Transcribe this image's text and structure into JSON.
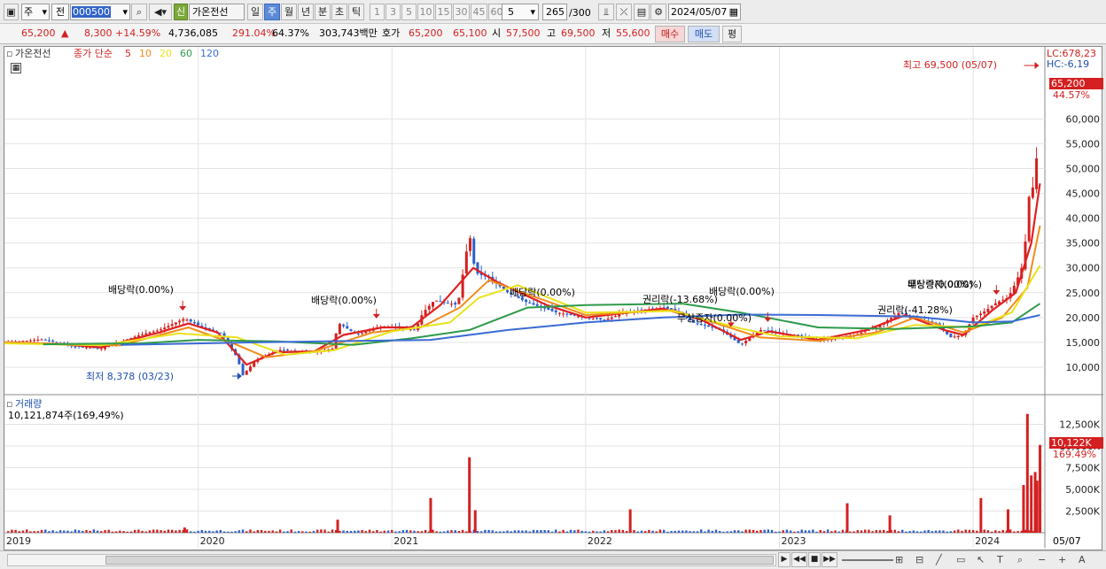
{
  "toolbar": {
    "type": "주",
    "mode": "전",
    "code": "000500",
    "new_badge": "신",
    "name": "가온전선",
    "periods": [
      "일",
      "주",
      "월",
      "년",
      "분",
      "초",
      "틱"
    ],
    "selected_period": "주",
    "intervals": [
      "1",
      "3",
      "5",
      "10",
      "15",
      "30",
      "45",
      "60"
    ],
    "interval_value": "5",
    "count": "265",
    "count_total": "/300",
    "date": "2024/05/07"
  },
  "quote": {
    "price": "65,200",
    "arrow": "▲",
    "change": "8,300",
    "change_pct": "+14.59%",
    "volume": "4,736,085",
    "vol_ratio": "291.04%",
    "turnover": "64.37%",
    "amount": "303,743백만",
    "bid_label": "호가",
    "ask": "65,200",
    "bid": "65,100",
    "open_label": "시",
    "open": "57,500",
    "high_label": "고",
    "high": "69,500",
    "low_label": "저",
    "low": "55,600",
    "buy": "매수",
    "sell": "매도",
    "eval": "평"
  },
  "legend": {
    "name": "가온전선",
    "prefix": "종가 단순",
    "ma": [
      {
        "label": "5",
        "color": "#e02020"
      },
      {
        "label": "10",
        "color": "#f08c1c"
      },
      {
        "label": "20",
        "color": "#e8e21a"
      },
      {
        "label": "60",
        "color": "#2e9a4a"
      },
      {
        "label": "120",
        "color": "#3a6bd4"
      }
    ]
  },
  "annotations": {
    "high": "최고 69,500 (05/07)",
    "low": "최저 8,378 (03/23)",
    "div1": "배당락(0.00%)",
    "div2": "배당락(0.00%)",
    "div3": "배당락(0.00%)",
    "rights1": "권리락(-13.68%)",
    "bonus1": "무상증자(0.00%)",
    "div4": "배당락(0.00%)",
    "div5": "배당락(0.00%)",
    "bonus2": "무상증자(0.00%)",
    "rights2": "권리락(-41.28%)"
  },
  "price_axis": {
    "lc": "LC:678,23",
    "hc": "HC:-6,19",
    "last_price": "65,200",
    "last_pct": "44.57%"
  },
  "volume_panel": {
    "title": "거래량",
    "value": "10,121,874주(169,49%)",
    "axis_last": "10,122K",
    "axis_pct": "169.49%"
  },
  "date_end": "05/07",
  "colors": {
    "up": "#d42020",
    "down": "#2a5fd0",
    "accent": "#5b8bd6"
  },
  "chart_data": {
    "type": "candlestick",
    "price": {
      "x_years": [
        "2019",
        "2020",
        "2021",
        "2022",
        "2023",
        "2024"
      ],
      "ylim": [
        5000,
        72000
      ],
      "yticks": [
        10000,
        15000,
        20000,
        25000,
        30000,
        35000,
        40000,
        45000,
        50000,
        55000,
        60000
      ],
      "ytick_labels": [
        "10,000",
        "15,000",
        "20,000",
        "25,000",
        "30,000",
        "35,000",
        "40,000",
        "45,000",
        "50,000",
        "55,000",
        "60,000"
      ],
      "close_path": [
        [
          2019.0,
          15000
        ],
        [
          2019.2,
          15600
        ],
        [
          2019.35,
          14200
        ],
        [
          2019.5,
          13800
        ],
        [
          2019.7,
          16500
        ],
        [
          2019.8,
          17500
        ],
        [
          2019.93,
          19800
        ],
        [
          2020.05,
          17500
        ],
        [
          2020.12,
          16800
        ],
        [
          2020.2,
          12000
        ],
        [
          2020.23,
          8378
        ],
        [
          2020.3,
          11500
        ],
        [
          2020.42,
          13500
        ],
        [
          2020.5,
          13200
        ],
        [
          2020.6,
          13000
        ],
        [
          2020.7,
          13800
        ],
        [
          2020.72,
          19000
        ],
        [
          2020.82,
          16500
        ],
        [
          2020.92,
          18000
        ],
        [
          2021.0,
          18200
        ],
        [
          2021.12,
          17500
        ],
        [
          2021.16,
          21000
        ],
        [
          2021.22,
          23500
        ],
        [
          2021.34,
          22500
        ],
        [
          2021.4,
          37000
        ],
        [
          2021.43,
          29000
        ],
        [
          2021.5,
          28000
        ],
        [
          2021.6,
          25000
        ],
        [
          2021.7,
          23000
        ],
        [
          2021.85,
          21000
        ],
        [
          2022.0,
          20000
        ],
        [
          2022.1,
          19500
        ],
        [
          2022.2,
          21000
        ],
        [
          2022.4,
          22000
        ],
        [
          2022.5,
          21000
        ],
        [
          2022.55,
          19000
        ],
        [
          2022.7,
          17500
        ],
        [
          2022.8,
          14500
        ],
        [
          2022.9,
          17500
        ],
        [
          2023.0,
          17000
        ],
        [
          2023.2,
          15500
        ],
        [
          2023.35,
          16000
        ],
        [
          2023.5,
          18000
        ],
        [
          2023.62,
          21000
        ],
        [
          2023.7,
          20000
        ],
        [
          2023.82,
          18500
        ],
        [
          2023.88,
          16000
        ],
        [
          2023.95,
          16500
        ],
        [
          2024.0,
          20000
        ],
        [
          2024.05,
          21000
        ],
        [
          2024.12,
          23000
        ],
        [
          2024.18,
          24000
        ],
        [
          2024.22,
          27000
        ],
        [
          2024.26,
          31000
        ],
        [
          2024.29,
          45000
        ],
        [
          2024.32,
          47000
        ],
        [
          2024.345,
          65200
        ]
      ],
      "ma": [
        {
          "name": "5",
          "points": [
            [
              2019.0,
              15000
            ],
            [
              2019.3,
              14600
            ],
            [
              2019.5,
              14000
            ],
            [
              2019.8,
              17000
            ],
            [
              2019.95,
              18800
            ],
            [
              2020.1,
              17000
            ],
            [
              2020.25,
              10500
            ],
            [
              2020.4,
              13000
            ],
            [
              2020.6,
              13200
            ],
            [
              2020.75,
              16500
            ],
            [
              2020.95,
              18000
            ],
            [
              2021.1,
              18000
            ],
            [
              2021.25,
              22500
            ],
            [
              2021.42,
              30000
            ],
            [
              2021.55,
              27000
            ],
            [
              2021.8,
              22500
            ],
            [
              2022.0,
              20000
            ],
            [
              2022.4,
              21800
            ],
            [
              2022.6,
              19500
            ],
            [
              2022.8,
              15500
            ],
            [
              2022.95,
              17200
            ],
            [
              2023.2,
              15500
            ],
            [
              2023.45,
              17500
            ],
            [
              2023.65,
              20500
            ],
            [
              2023.85,
              17500
            ],
            [
              2023.95,
              16500
            ],
            [
              2024.1,
              21500
            ],
            [
              2024.22,
              25000
            ],
            [
              2024.3,
              35000
            ],
            [
              2024.345,
              47000
            ]
          ]
        },
        {
          "name": "10",
          "points": [
            [
              2019.0,
              15000
            ],
            [
              2019.4,
              14600
            ],
            [
              2019.6,
              14400
            ],
            [
              2019.95,
              18000
            ],
            [
              2020.2,
              14500
            ],
            [
              2020.35,
              12000
            ],
            [
              2020.6,
              13200
            ],
            [
              2020.9,
              17000
            ],
            [
              2021.15,
              18000
            ],
            [
              2021.35,
              22000
            ],
            [
              2021.5,
              27500
            ],
            [
              2021.75,
              24000
            ],
            [
              2022.0,
              20500
            ],
            [
              2022.45,
              21500
            ],
            [
              2022.7,
              18500
            ],
            [
              2022.9,
              16000
            ],
            [
              2023.2,
              15300
            ],
            [
              2023.5,
              17000
            ],
            [
              2023.7,
              20000
            ],
            [
              2023.95,
              17000
            ],
            [
              2024.15,
              20000
            ],
            [
              2024.28,
              26000
            ],
            [
              2024.345,
              38500
            ]
          ]
        },
        {
          "name": "20",
          "points": [
            [
              2019.0,
              14800
            ],
            [
              2019.5,
              14400
            ],
            [
              2019.9,
              16800
            ],
            [
              2020.2,
              16000
            ],
            [
              2020.45,
              12500
            ],
            [
              2020.7,
              13400
            ],
            [
              2021.0,
              17200
            ],
            [
              2021.3,
              19000
            ],
            [
              2021.45,
              24000
            ],
            [
              2021.65,
              26500
            ],
            [
              2022.0,
              21000
            ],
            [
              2022.45,
              21300
            ],
            [
              2022.8,
              17800
            ],
            [
              2023.0,
              16200
            ],
            [
              2023.4,
              15800
            ],
            [
              2023.7,
              18500
            ],
            [
              2024.0,
              18000
            ],
            [
              2024.2,
              21000
            ],
            [
              2024.345,
              30500
            ]
          ]
        },
        {
          "name": "60",
          "points": [
            [
              2019.2,
              14600
            ],
            [
              2019.7,
              14800
            ],
            [
              2020.0,
              15500
            ],
            [
              2020.4,
              15200
            ],
            [
              2020.8,
              14500
            ],
            [
              2021.1,
              15800
            ],
            [
              2021.4,
              17500
            ],
            [
              2021.7,
              22000
            ],
            [
              2022.0,
              22500
            ],
            [
              2022.5,
              22800
            ],
            [
              2022.8,
              21000
            ],
            [
              2023.2,
              18000
            ],
            [
              2023.6,
              17700
            ],
            [
              2024.0,
              18200
            ],
            [
              2024.2,
              19000
            ],
            [
              2024.345,
              22800
            ]
          ]
        },
        {
          "name": "120",
          "points": [
            [
              2019.6,
              14500
            ],
            [
              2020.3,
              15000
            ],
            [
              2020.8,
              15300
            ],
            [
              2021.2,
              15500
            ],
            [
              2021.6,
              17500
            ],
            [
              2022.0,
              19000
            ],
            [
              2022.4,
              20000
            ],
            [
              2022.8,
              20600
            ],
            [
              2023.2,
              20500
            ],
            [
              2023.7,
              20200
            ],
            [
              2024.0,
              19000
            ],
            [
              2024.2,
              19200
            ],
            [
              2024.345,
              20500
            ]
          ]
        }
      ]
    },
    "volume": {
      "ylim": [
        0,
        15000
      ],
      "yticks_k": [
        2500,
        5000,
        7500,
        10000,
        12500
      ],
      "ytick_labels": [
        "2,500K",
        "5,000K",
        "7,500K",
        "10,000K",
        "12,500K"
      ],
      "spikes_k": [
        [
          2019.93,
          600
        ],
        [
          2020.72,
          1500
        ],
        [
          2021.2,
          4000
        ],
        [
          2021.4,
          8700
        ],
        [
          2021.43,
          2600
        ],
        [
          2022.23,
          2700
        ],
        [
          2023.35,
          3400
        ],
        [
          2023.57,
          2000
        ],
        [
          2024.04,
          4000
        ],
        [
          2024.18,
          2700
        ],
        [
          2024.26,
          5500
        ],
        [
          2024.28,
          13700
        ],
        [
          2024.3,
          6600
        ],
        [
          2024.32,
          7000
        ],
        [
          2024.33,
          6000
        ],
        [
          2024.345,
          10122
        ]
      ]
    }
  }
}
